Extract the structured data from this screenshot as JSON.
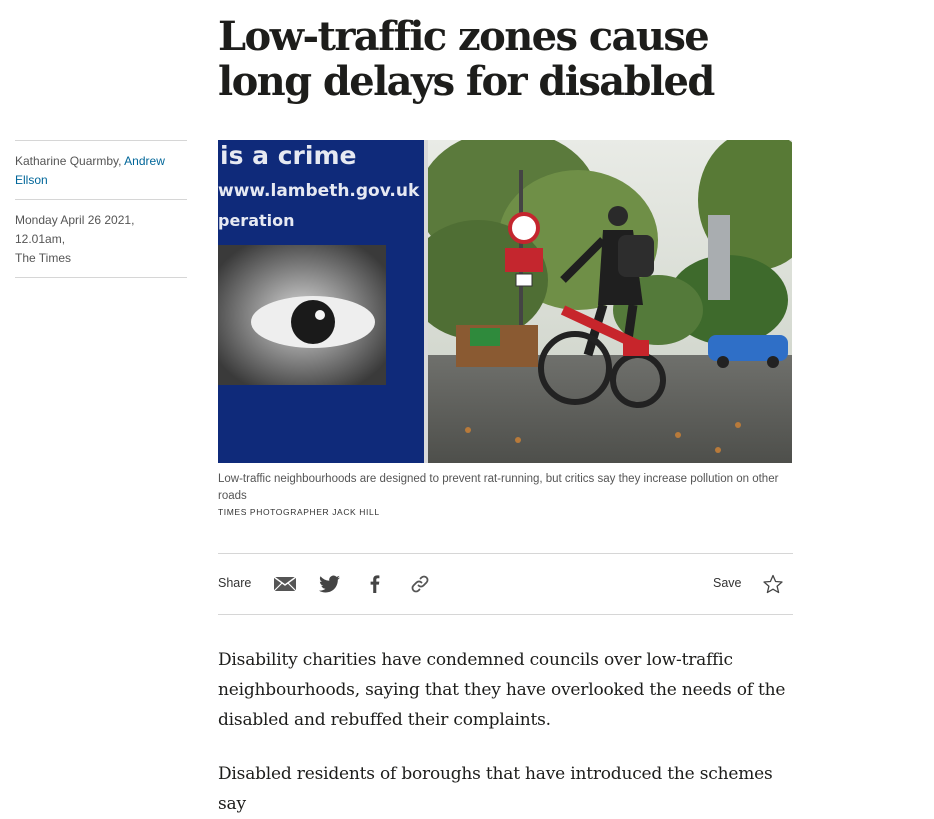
{
  "article": {
    "headline": "Low-traffic zones cause long delays for disabled",
    "byline": {
      "author1": "Katharine Quarmby, ",
      "author2": "Andrew Ellson",
      "date": "Monday April 26 2021, 12.01am,",
      "publication": "The Times"
    },
    "image": {
      "poster_line1": "is a crime",
      "poster_line2": "www.lambeth.gov.uk",
      "poster_line3": "peration",
      "caption": "Low-traffic neighbourhoods are designed to prevent rat-running, but critics say they increase pollution on other roads",
      "credit": "TIMES PHOTOGRAPHER JACK HILL"
    },
    "share": {
      "label": "Share",
      "save_label": "Save",
      "icons": [
        "email-icon",
        "twitter-icon",
        "facebook-icon",
        "link-icon",
        "star-icon"
      ]
    },
    "paragraphs": [
      "Disability charities have condemned councils over low-traffic neighbourhoods, saying that they have overlooked the needs of the disabled and rebuffed their complaints.",
      "Disabled residents of boroughs that have introduced the schemes say"
    ]
  }
}
